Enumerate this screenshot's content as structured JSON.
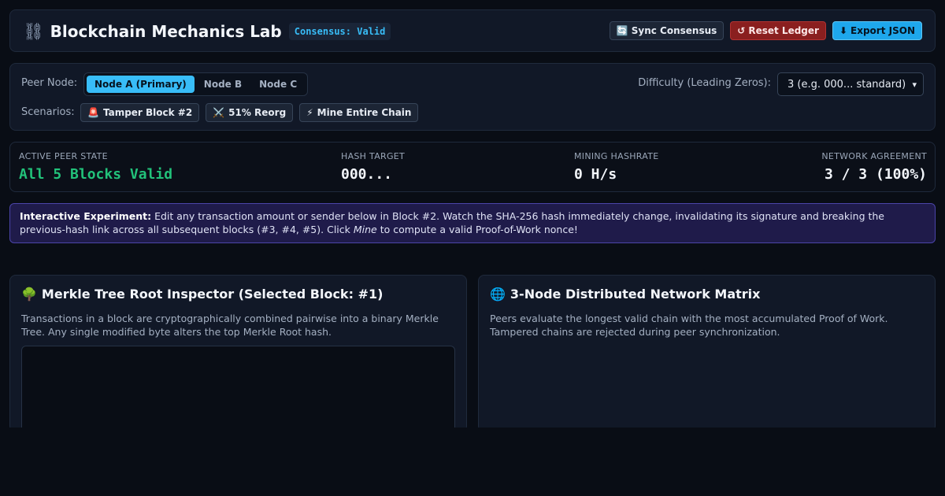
{
  "header": {
    "logo_icon": "⛓",
    "title": "Blockchain Mechanics Lab",
    "consensus_badge": "Consensus: Valid",
    "buttons": {
      "sync": {
        "icon": "🔄",
        "label": "Sync Consensus"
      },
      "reset": {
        "icon": "↺",
        "label": "Reset Ledger"
      },
      "export": {
        "icon": "⬇",
        "label": "Export JSON"
      }
    }
  },
  "controls": {
    "peer_label": "Peer Node:",
    "peers": [
      "Node A (Primary)",
      "Node B",
      "Node C"
    ],
    "active_peer_index": 0,
    "difficulty_label": "Difficulty (Leading Zeros):",
    "difficulty_value": "3 (e.g. 000... standard)",
    "scenarios_label": "Scenarios:",
    "scenarios": [
      {
        "icon": "🚨",
        "label": "Tamper Block #2"
      },
      {
        "icon": "⚔️",
        "label": "51% Reorg"
      },
      {
        "icon": "⚡",
        "label": "Mine Entire Chain"
      }
    ]
  },
  "stats": {
    "active_peer_state": {
      "label": "ACTIVE PEER STATE",
      "value": "All 5 Blocks Valid"
    },
    "hash_target": {
      "label": "HASH TARGET",
      "value": "000..."
    },
    "mining_hashrate": {
      "label": "MINING HASHRATE",
      "value": "0 H/s"
    },
    "network_agreement": {
      "label": "NETWORK AGREEMENT",
      "value": "3 / 3 (100%)"
    }
  },
  "info": {
    "lead": "Interactive Experiment:",
    "text_1": " Edit any transaction amount or sender below in Block #2. Watch the SHA-256 hash immediately change, invalidating its signature and breaking the previous-hash link across all subsequent blocks (#3, #4, #5). Click ",
    "emph": "Mine",
    "text_2": " to compute a valid Proof-of-Work nonce!"
  },
  "merkle": {
    "icon": "🌳",
    "title": "Merkle Tree Root Inspector (Selected Block: #1)",
    "description": "Transactions in a block are cryptographically combined pairwise into a binary Merkle Tree. Any single modified byte alters the top Merkle Root hash."
  },
  "network": {
    "icon": "🌐",
    "title": "3-Node Distributed Network Matrix",
    "description": "Peers evaluate the longest valid chain with the most accumulated Proof of Work. Tampered chains are rejected during peer synchronization."
  },
  "colors": {
    "accent": "#38bdf8",
    "valid": "#22c27a",
    "danger": "#8a1f1f",
    "info_bg": "#1f1b4a"
  }
}
